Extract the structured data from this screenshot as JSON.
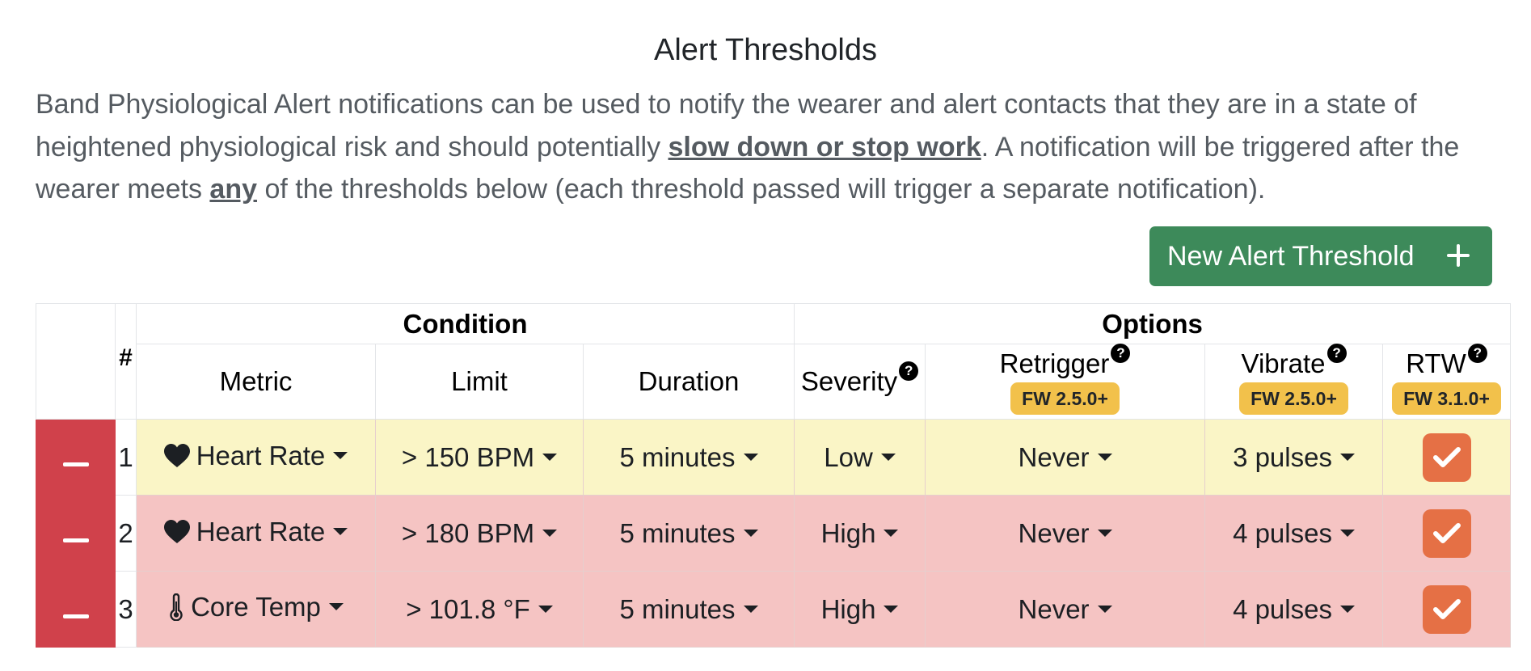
{
  "page": {
    "title": "Alert Thresholds",
    "description": {
      "part1": "Band Physiological Alert notifications can be used to notify the wearer and alert contacts that they are in a state of heightened physiological risk and should potentially ",
      "emphasis1": "slow down or stop work",
      "part2": ". A notification will be triggered after the wearer meets ",
      "emphasis2": "any",
      "part3": " of the thresholds below (each threshold passed will trigger a separate notification)."
    },
    "new_button_label": "New Alert Threshold"
  },
  "table": {
    "groups": {
      "condition": "Condition",
      "options": "Options"
    },
    "hash_header": "#",
    "headers": {
      "metric": "Metric",
      "limit": "Limit",
      "duration": "Duration",
      "severity": "Severity",
      "retrigger": "Retrigger",
      "vibrate": "Vibrate",
      "rtw": "RTW"
    },
    "help_glyph": "?",
    "badges": {
      "retrigger": "FW 2.5.0+",
      "vibrate": "FW 2.5.0+",
      "rtw": "FW 3.1.0+"
    },
    "rows": [
      {
        "num": "1",
        "metric_icon": "heart-icon",
        "metric": "Heart Rate",
        "limit": "> 150 BPM",
        "duration": "5 minutes",
        "severity": "Low",
        "retrigger": "Never",
        "vibrate": "3 pulses",
        "rtw_checked": true,
        "row_color": "#faf5c6"
      },
      {
        "num": "2",
        "metric_icon": "heart-icon",
        "metric": "Heart Rate",
        "limit": "> 180 BPM",
        "duration": "5 minutes",
        "severity": "High",
        "retrigger": "Never",
        "vibrate": "4 pulses",
        "rtw_checked": true,
        "row_color": "#f5c4c3"
      },
      {
        "num": "3",
        "metric_icon": "thermometer-icon",
        "metric": "Core Temp",
        "limit": "> 101.8 °F",
        "duration": "5 minutes",
        "severity": "High",
        "retrigger": "Never",
        "vibrate": "4 pulses",
        "rtw_checked": true,
        "row_color": "#f5c4c3"
      }
    ]
  },
  "colors": {
    "primary_button": "#3d8a5a",
    "remove_button": "#d0414b",
    "badge": "#f2c14b",
    "checkbox": "#e57045",
    "low_severity_row": "#faf5c6",
    "high_severity_row": "#f5c4c3"
  }
}
